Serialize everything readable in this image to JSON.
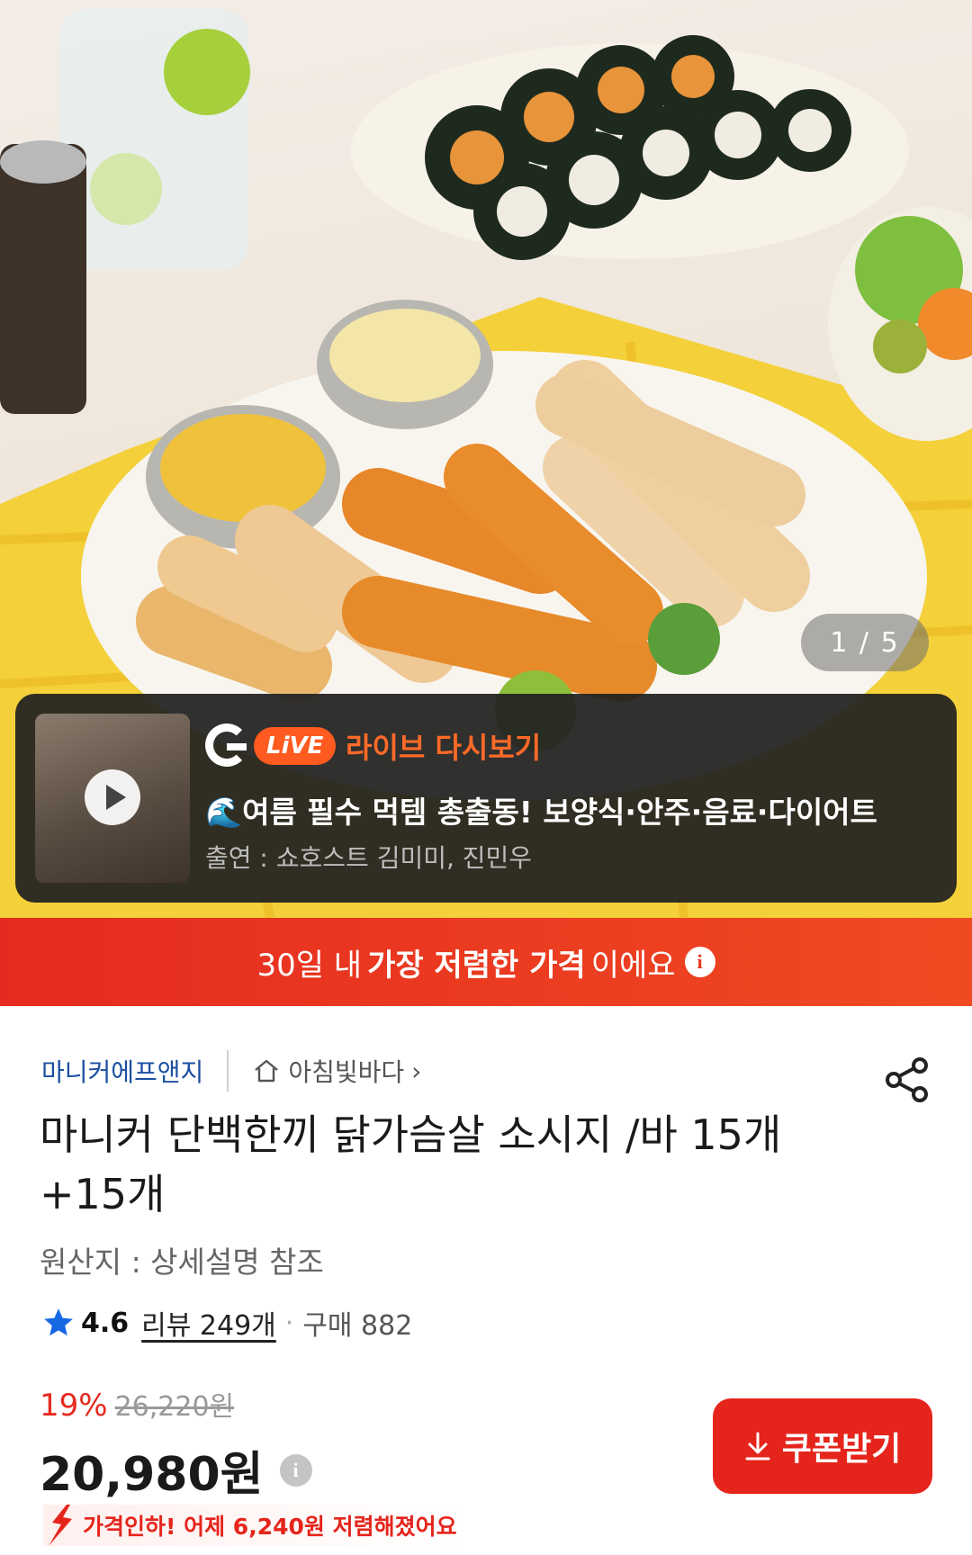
{
  "gallery": {
    "counter": "1 / 5"
  },
  "live": {
    "badge": "LiVE",
    "title": "라이브 다시보기",
    "emoji": "🌊",
    "description": "여름 필수 먹템 총출동! 보양식·안주·음료·다이어트",
    "cast": "출연 : 쇼호스트 김미미, 진민우"
  },
  "price_banner": {
    "prefix": "30일 내",
    "highlight": "가장 저렴한 가격",
    "suffix": "이에요",
    "info": "i"
  },
  "product": {
    "seller": "마니커에프앤지",
    "store": "아침빛바다",
    "title": "마니커 단백한끼 닭가슴살 소시지 /바 15개+15개",
    "origin": "원산지 : 상세설명 참조",
    "rating": "4.6",
    "reviews": "리뷰 249개",
    "purchases": "구매 882",
    "discount": "19%",
    "original_price": "26,220원",
    "price": "20,980원",
    "coupon_button": "쿠폰받기",
    "price_drop": "가격인하! 어제 6,240원 저렴해졌어요"
  },
  "colors": {
    "accent_red": "#e5251c",
    "seller_blue": "#1c4fa0",
    "live_orange": "#ff5a1f"
  }
}
